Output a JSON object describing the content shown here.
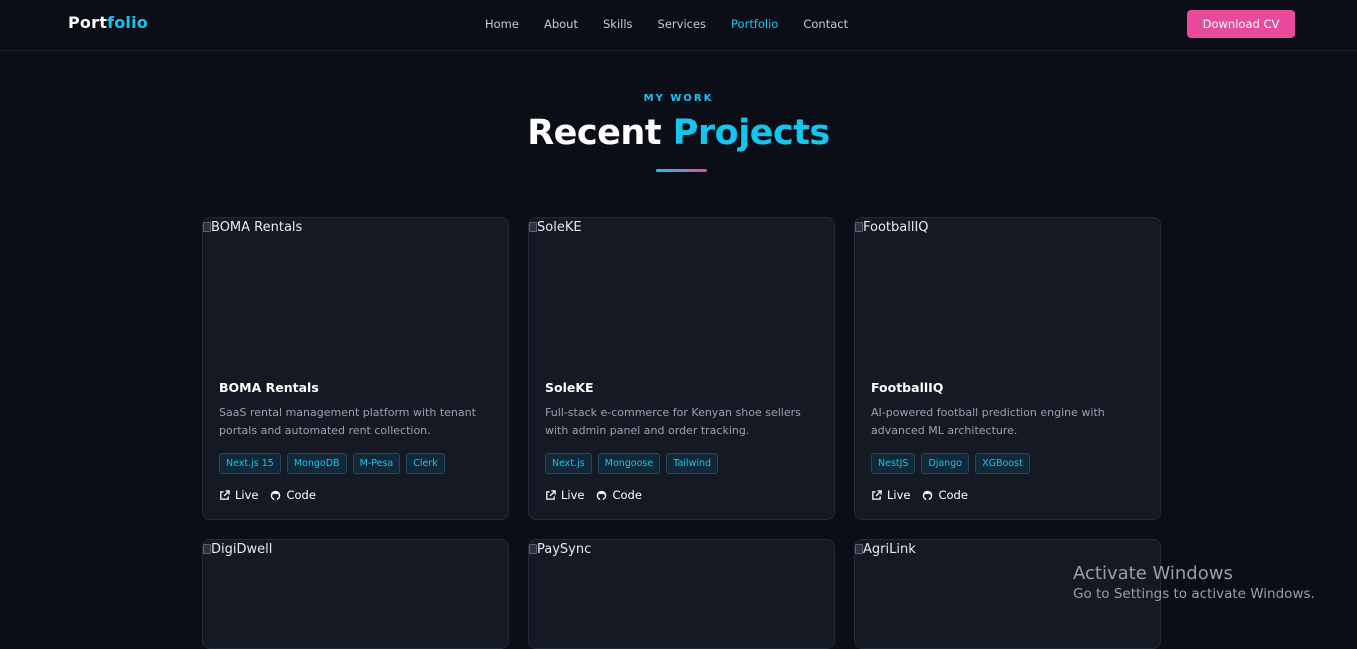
{
  "nav": {
    "logo_main": "Port",
    "logo_accent": "folio",
    "links": [
      {
        "label": "Home",
        "active": false
      },
      {
        "label": "About",
        "active": false
      },
      {
        "label": "Skills",
        "active": false
      },
      {
        "label": "Services",
        "active": false
      },
      {
        "label": "Portfolio",
        "active": true
      },
      {
        "label": "Contact",
        "active": false
      }
    ],
    "cta_label": "Download CV"
  },
  "section": {
    "eyebrow": "MY WORK",
    "title_main": "Recent",
    "title_accent": "Projects"
  },
  "projects": [
    {
      "image_alt": "BOMA Rentals",
      "name": "BOMA Rentals",
      "description": "SaaS rental management platform with tenant portals and automated rent collection.",
      "tags": [
        "Next.js 15",
        "MongoDB",
        "M-Pesa",
        "Clerk"
      ],
      "live_label": "Live",
      "code_label": "Code"
    },
    {
      "image_alt": "SoleKE",
      "name": "SoleKE",
      "description": "Full-stack e-commerce for Kenyan shoe sellers with admin panel and order tracking.",
      "tags": [
        "Next.js",
        "Mongoose",
        "Tailwind"
      ],
      "live_label": "Live",
      "code_label": "Code"
    },
    {
      "image_alt": "FootballIQ",
      "name": "FootballIQ",
      "description": "AI-powered football prediction engine with advanced ML architecture.",
      "tags": [
        "NestJS",
        "Django",
        "XGBoost"
      ],
      "live_label": "Live",
      "code_label": "Code"
    },
    {
      "image_alt": "DigiDwell"
    },
    {
      "image_alt": "PaySync"
    },
    {
      "image_alt": "AgriLink"
    }
  ],
  "watermark": {
    "line1": "Activate Windows",
    "line2": "Go to Settings to activate Windows."
  },
  "colors": {
    "background": "#0b0e17",
    "accent_cyan": "#13c6f1",
    "accent_pink": "#e94a9b",
    "card": "#141923"
  }
}
